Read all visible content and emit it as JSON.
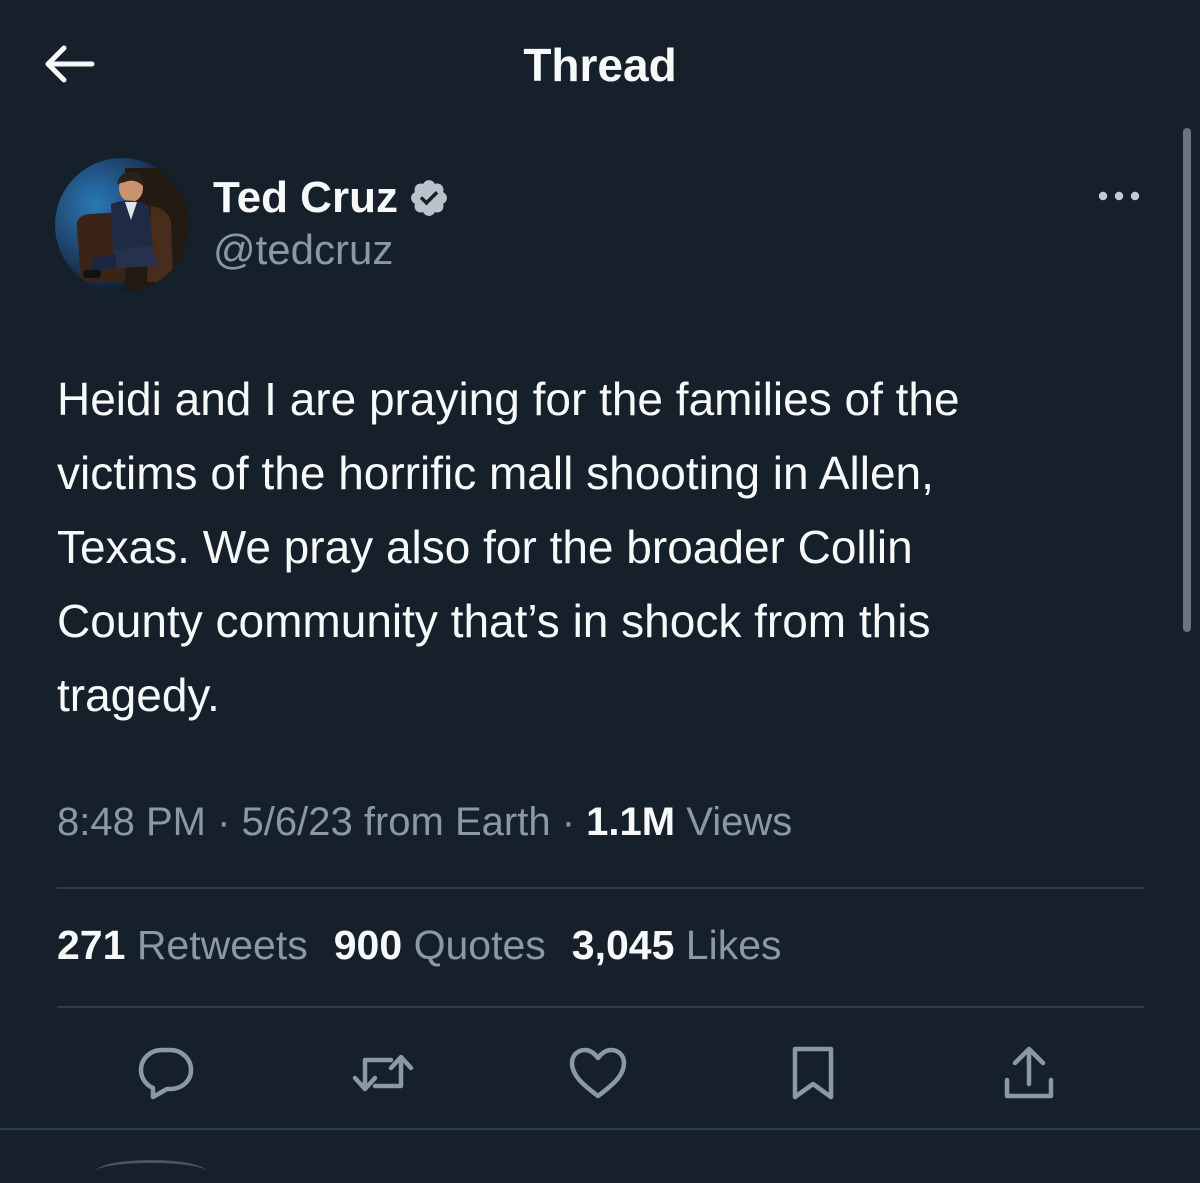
{
  "header": {
    "title": "Thread",
    "back_icon": "arrow-left-icon"
  },
  "tweet": {
    "author": {
      "name": "Ted Cruz",
      "handle": "@tedcruz",
      "verified": true
    },
    "text": "Heidi and I are praying for the families of the\nvictims of the horrific  mall shooting in Allen,\nTexas. We pray also for the broader Collin\nCounty community that’s in shock from this\ntragedy.",
    "time": "8:48 PM",
    "date_source": "5/6/23 from Earth",
    "separator": "·",
    "views_count": "1.1M",
    "views_label": "Views"
  },
  "stats": {
    "retweets_count": "271",
    "retweets_label": "Retweets",
    "quotes_count": "900",
    "quotes_label": "Quotes",
    "likes_count": "3,045",
    "likes_label": "Likes"
  },
  "actions": [
    "reply-icon",
    "retweet-icon",
    "like-icon",
    "bookmark-icon",
    "share-icon"
  ],
  "colors": {
    "background": "#15202b",
    "text_primary": "#f7f9f9",
    "text_secondary": "#8b98a5",
    "divider": "#2f3b47"
  }
}
